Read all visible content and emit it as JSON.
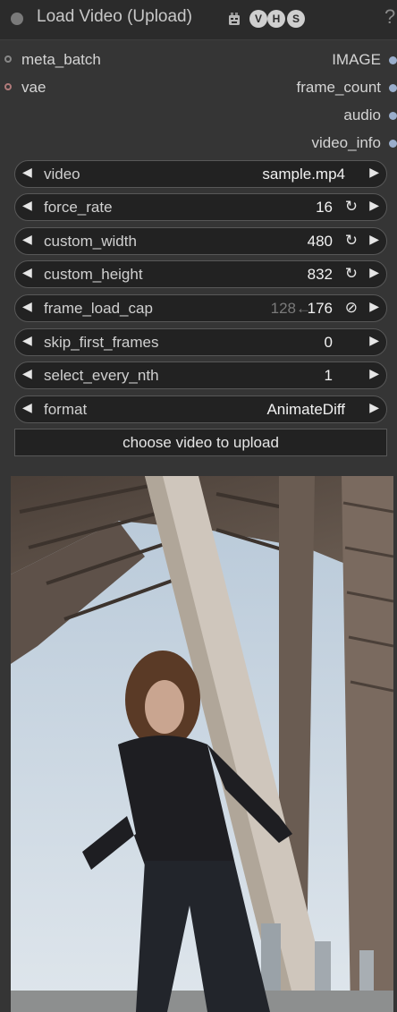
{
  "node": {
    "title": "Load Video (Upload)",
    "badges": [
      "V",
      "H",
      "S"
    ],
    "help": "?"
  },
  "inputs": [
    "meta_batch",
    "vae"
  ],
  "outputs": [
    "IMAGE",
    "frame_count",
    "audio",
    "video_info"
  ],
  "widgets": {
    "video": {
      "name": "video",
      "value": "sample.mp4"
    },
    "force_rate": {
      "name": "force_rate",
      "value": "16"
    },
    "custom_width": {
      "name": "custom_width",
      "value": "480"
    },
    "custom_height": {
      "name": "custom_height",
      "value": "832"
    },
    "frame_load_cap": {
      "name": "frame_load_cap",
      "hint": "128←",
      "value": "176"
    },
    "skip_first_frames": {
      "name": "skip_first_frames",
      "value": "0"
    },
    "select_every_nth": {
      "name": "select_every_nth",
      "value": "1"
    },
    "format": {
      "name": "format",
      "value": "AnimateDiff"
    }
  },
  "upload_button": "choose video to upload",
  "colors": {
    "node_bg": "#353535",
    "title_bg": "#2b2b2b",
    "widget_bg": "#222222",
    "output_dot": "#9aaecc"
  }
}
